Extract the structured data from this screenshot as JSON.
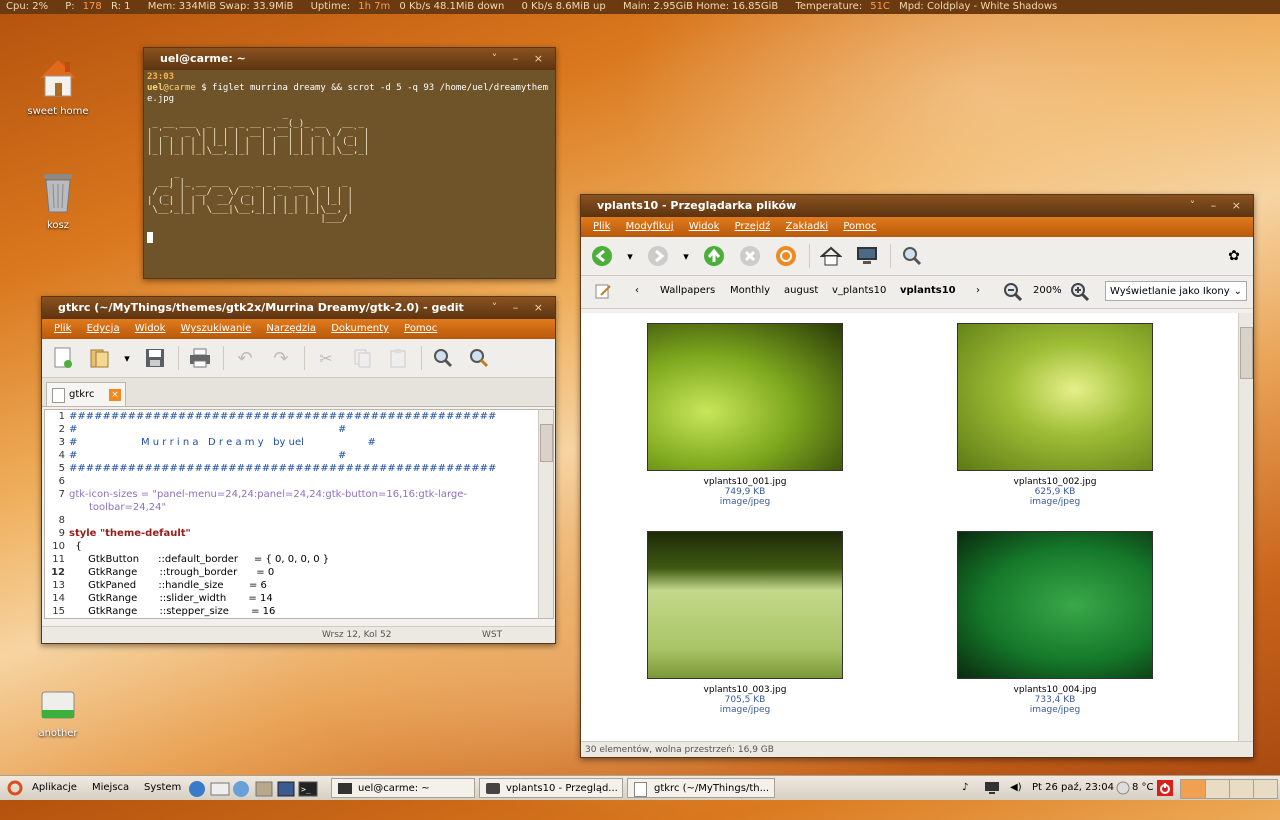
{
  "conky": {
    "cpu": "Cpu: 2%",
    "p": "P:",
    "p_val": "178",
    "r": "R: 1",
    "mem": "Mem: 334MiB Swap: 33.9MiB",
    "uptime": "Uptime:",
    "uptime_val": "1h 7m",
    "net_down": "0 Kb/s  48.1MiB down",
    "net_up": "0 Kb/s  8.6MiB up",
    "disk": "Main: 2.95GiB  Home: 16.85GiB",
    "temp": "Temperature:",
    "temp_val": "51C",
    "mpd": "Mpd:  Coldplay - White Shadows"
  },
  "desktop": {
    "home_label": "sweet home",
    "trash_label": "kosz",
    "drive_label": "another"
  },
  "terminal": {
    "title": "uel@carme: ~",
    "time": "23:03",
    "user": "uel",
    "at": "@",
    "host": "carme",
    "command": "$ figlet murrina dreamy && scrot -d 5 -q 93 /home/uel/dreamytheme.jpg",
    "figlet1": "                         _\n _ __ ___  _   _ _ __ _ __(_)_ __   __ _\n| '_ ` _ \\| | | | '__| '__| | '_ \\ / _` |\n| | | | | | |_| | |  | |  | | | | | (_| |\n|_| |_| |_|\\__,_|_|  |_|  |_|_| |_|\\__,_|",
    "figlet2": "     _\n  __| |_ __ ___  __ _ _ __ ___  _   _\n / _` | '__/ _ \\/ _` | '_ ` _ \\| | | |\n| (_| | | |  __/ (_| | | | | | | |_| |\n \\__,_|_|  \\___|\\__,_|_| |_| |_|\\__, |\n                                |___/"
  },
  "gedit": {
    "title": "gtkrc (~/MyThings/themes/gtk2x/Murrina Dreamy/gtk-2.0) - gedit",
    "menu": [
      "Plik",
      "Edycja",
      "Widok",
      "Wyszukiwanie",
      "Narzędzia",
      "Dokumenty",
      "Pomoc"
    ],
    "tab_label": "gtkrc",
    "lines": [
      {
        "n": "1",
        "t": "###################################################"
      },
      {
        "n": "2",
        "t": "#                                                                                  #"
      },
      {
        "n": "3",
        "t": "#                    M u r r i n a   D r e a m y   by uel                    #"
      },
      {
        "n": "4",
        "t": "#                                                                                  #"
      },
      {
        "n": "5",
        "t": "###################################################"
      },
      {
        "n": "6",
        "t": ""
      },
      {
        "n": "7",
        "t": "gtk-icon-sizes = \"panel-menu=24,24:panel=24,24:gtk-button=16,16:gtk-large-"
      },
      {
        "n": "",
        "t": "toolbar=24,24\""
      },
      {
        "n": "8",
        "t": ""
      },
      {
        "n": "9",
        "t": "style \"theme-default\""
      },
      {
        "n": "10",
        "t": "  {"
      },
      {
        "n": "11",
        "t": "      GtkButton      ::default_border     = { 0, 0, 0, 0 }"
      },
      {
        "n": "12",
        "t": "      GtkRange       ::trough_border      = 0"
      },
      {
        "n": "13",
        "t": "      GtkPaned       ::handle_size        = 6"
      },
      {
        "n": "14",
        "t": "      GtkRange       ::slider_width       = 14"
      },
      {
        "n": "15",
        "t": "      GtkRange       ::stepper_size       = 16"
      }
    ],
    "status_pos": "Wrsz 12, Kol 52",
    "status_mode": "WST"
  },
  "browser": {
    "title": "vplants10 - Przeglądarka plików",
    "menu": [
      "Plik",
      "Modyfikuj",
      "Widok",
      "Przejdź",
      "Zakładki",
      "Pomoc"
    ],
    "crumbs": [
      "Wallpapers",
      "Monthly",
      "august",
      "v_plants10",
      "vplants10"
    ],
    "zoom": "200%",
    "view_mode": "Wyświetlanie jako Ikony",
    "files": [
      {
        "name": "vplants10_001.jpg",
        "size": "749,9 KB",
        "type": "image/jpeg"
      },
      {
        "name": "vplants10_002.jpg",
        "size": "625,9 KB",
        "type": "image/jpeg"
      },
      {
        "name": "vplants10_003.jpg",
        "size": "705,5 KB",
        "type": "image/jpeg"
      },
      {
        "name": "vplants10_004.jpg",
        "size": "733,4 KB",
        "type": "image/jpeg"
      }
    ],
    "status": "30 elementów, wolna przestrzeń: 16,9 GB"
  },
  "panel": {
    "apps": "Aplikacje",
    "places": "Miejsca",
    "system": "System",
    "task1": "uel@carme: ~",
    "task2": "vplants10 - Przegląd...",
    "task3": "gtkrc (~/MyThings/th...",
    "clock": "Pt 26 paź, 23:04",
    "weather": "8 °C"
  },
  "colors": {
    "accent": "#e07a1c",
    "title_bg": "#5c3410",
    "terminal_bg": "#6e5428"
  }
}
